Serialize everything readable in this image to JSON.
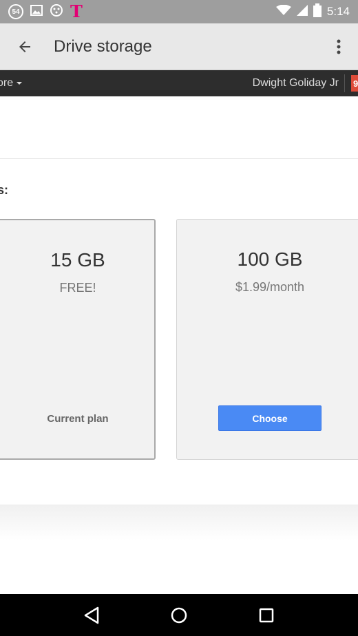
{
  "status_bar": {
    "notification_count": "54",
    "carrier_logo": "T",
    "time": "5:14",
    "icons": [
      "notification-count-icon",
      "image-icon",
      "android-icon",
      "tmobile-logo",
      "wifi-icon",
      "signal-icon",
      "battery-icon"
    ]
  },
  "app_bar": {
    "title": "Drive storage",
    "icons": [
      "back-arrow-icon",
      "overflow-menu-icon"
    ]
  },
  "google_bar": {
    "more_label": "ore",
    "user_name": "Dwight Goliday Jr",
    "notification_badge": "9"
  },
  "section_label": "s:",
  "plans": [
    {
      "size": "15 GB",
      "price": "FREE!",
      "action_label": "Current plan"
    },
    {
      "size": "100 GB",
      "price": "$1.99/month",
      "action_label": "Choose"
    }
  ],
  "colors": {
    "status_bar": "#9e9e9e",
    "app_bar": "#e8e8e8",
    "google_bar": "#2d2d2d",
    "accent_button": "#4a8af4",
    "notification_badge": "#dd4b39",
    "carrier_magenta": "#e20074"
  },
  "nav_bar": {
    "icons": [
      "back-triangle-icon",
      "home-circle-icon",
      "recents-square-icon"
    ]
  }
}
